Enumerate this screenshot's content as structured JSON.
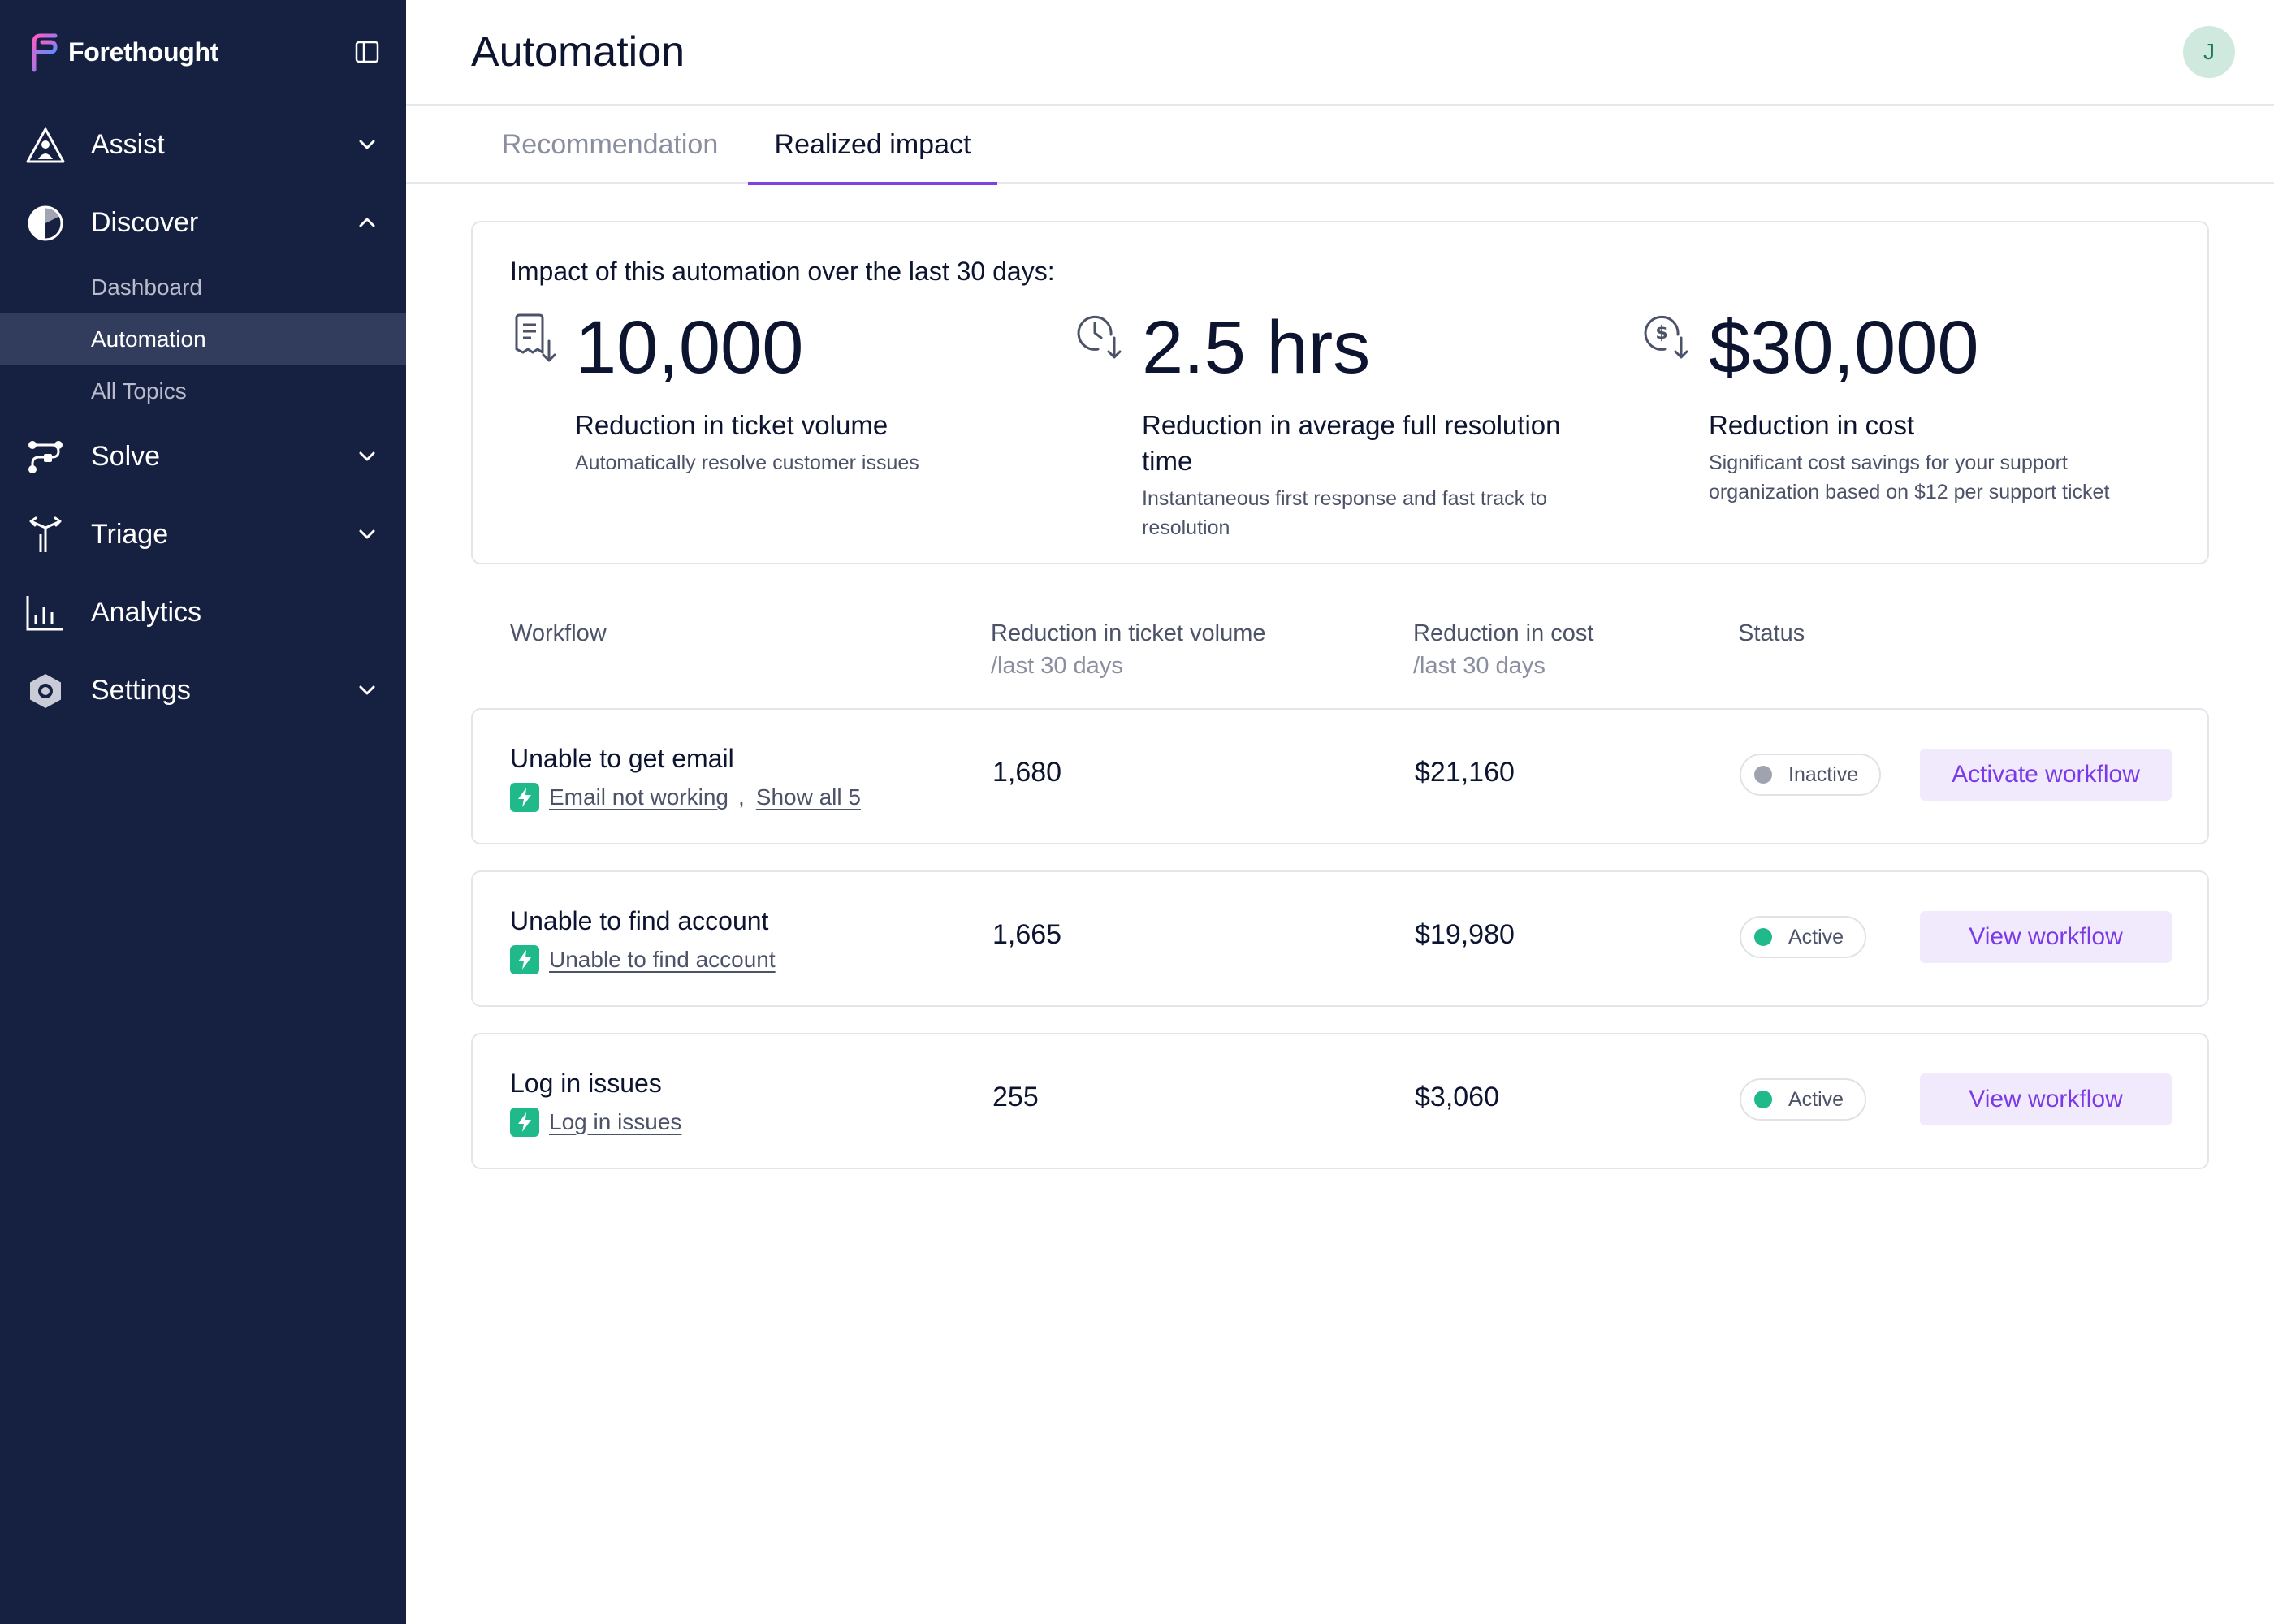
{
  "brand": {
    "name": "Forethought"
  },
  "sidebar": {
    "items": [
      {
        "label": "Assist",
        "icon": "assist-icon"
      },
      {
        "label": "Discover",
        "icon": "discover-icon"
      },
      {
        "label": "Solve",
        "icon": "solve-icon"
      },
      {
        "label": "Triage",
        "icon": "triage-icon"
      },
      {
        "label": "Analytics",
        "icon": "analytics-icon"
      },
      {
        "label": "Settings",
        "icon": "settings-icon"
      }
    ],
    "discover_sub": [
      {
        "label": "Dashboard"
      },
      {
        "label": "Automation"
      },
      {
        "label": "All Topics"
      }
    ]
  },
  "header": {
    "title": "Automation",
    "avatar_initial": "J"
  },
  "tabs": [
    {
      "label": "Recommendation"
    },
    {
      "label": "Realized impact"
    }
  ],
  "impact": {
    "heading": "Impact of this automation over the last 30 days:",
    "metrics": [
      {
        "value": "10,000",
        "title": "Reduction in ticket volume",
        "desc": "Automatically resolve customer issues"
      },
      {
        "value": "2.5 hrs",
        "title": "Reduction in average full resolution time",
        "desc": "Instantaneous first response and fast track to resolution"
      },
      {
        "value": "$30,000",
        "title": "Reduction in cost",
        "desc": "Significant cost savings for your support organization based on $12 per support ticket"
      }
    ]
  },
  "table": {
    "headers": {
      "workflow": "Workflow",
      "volume": "Reduction in ticket volume",
      "volume_sub": "/last 30 days",
      "cost": "Reduction in cost",
      "cost_sub": "/last 30 days",
      "status": "Status"
    },
    "rows": [
      {
        "name": "Unable to get email",
        "link": "Email not working",
        "sep": ",",
        "extra_link": "Show all 5",
        "volume": "1,680",
        "cost": "$21,160",
        "status": "Inactive",
        "action": "Activate workflow"
      },
      {
        "name": "Unable to find account",
        "link": "Unable to find account",
        "volume": "1,665",
        "cost": "$19,980",
        "status": "Active",
        "action": "View workflow"
      },
      {
        "name": "Log in issues",
        "link": "Log in issues",
        "volume": "255",
        "cost": "$3,060",
        "status": "Active",
        "action": "View workflow"
      }
    ]
  },
  "colors": {
    "sidebar_bg": "#162040",
    "accent": "#7b42e8",
    "active_status": "#1fb98a",
    "inactive_status": "#a0a3af"
  }
}
